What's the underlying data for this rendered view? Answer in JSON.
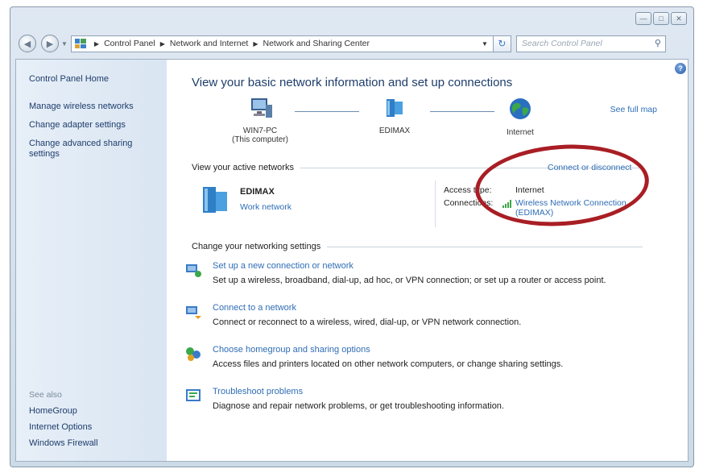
{
  "window": {
    "caption_buttons": [
      "minimize-icon",
      "maximize-icon",
      "close-icon"
    ]
  },
  "address_bar": {
    "breadcrumbs": [
      "Control Panel",
      "Network and Internet",
      "Network and Sharing Center"
    ],
    "search_placeholder": "Search Control Panel"
  },
  "sidebar": {
    "home": "Control Panel Home",
    "links": [
      "Manage wireless networks",
      "Change adapter settings",
      "Change advanced sharing settings"
    ],
    "see_also_header": "See also",
    "see_also": [
      "HomeGroup",
      "Internet Options",
      "Windows Firewall"
    ]
  },
  "main": {
    "heading": "View your basic network information and set up connections",
    "see_full_map": "See full map",
    "map_nodes": [
      {
        "name": "WIN7-PC",
        "sub": "(This computer)",
        "icon": "computer-icon"
      },
      {
        "name": "EDIMAX",
        "sub": "",
        "icon": "router-icon"
      },
      {
        "name": "Internet",
        "sub": "",
        "icon": "globe-icon"
      }
    ],
    "active_networks_header": "View your active networks",
    "connect_link": "Connect or disconnect",
    "active_network": {
      "name": "EDIMAX",
      "type": "Work network",
      "access_type_label": "Access type:",
      "access_type_value": "Internet",
      "connections_label": "Connections:",
      "connection_value_line1": "Wireless Network Connection",
      "connection_value_line2": "(EDIMAX)"
    },
    "change_settings_header": "Change your networking settings",
    "tasks": [
      {
        "title": "Set up a new connection or network",
        "desc": "Set up a wireless, broadband, dial-up, ad hoc, or VPN connection; or set up a router or access point.",
        "icon": "new-connection-icon"
      },
      {
        "title": "Connect to a network",
        "desc": "Connect or reconnect to a wireless, wired, dial-up, or VPN network connection.",
        "icon": "connect-network-icon"
      },
      {
        "title": "Choose homegroup and sharing options",
        "desc": "Access files and printers located on other network computers, or change sharing settings.",
        "icon": "homegroup-icon"
      },
      {
        "title": "Troubleshoot problems",
        "desc": "Diagnose and repair network problems, or get troubleshooting information.",
        "icon": "troubleshoot-icon"
      }
    ]
  },
  "annotation": {
    "ellipse_color": "#a81e24"
  }
}
